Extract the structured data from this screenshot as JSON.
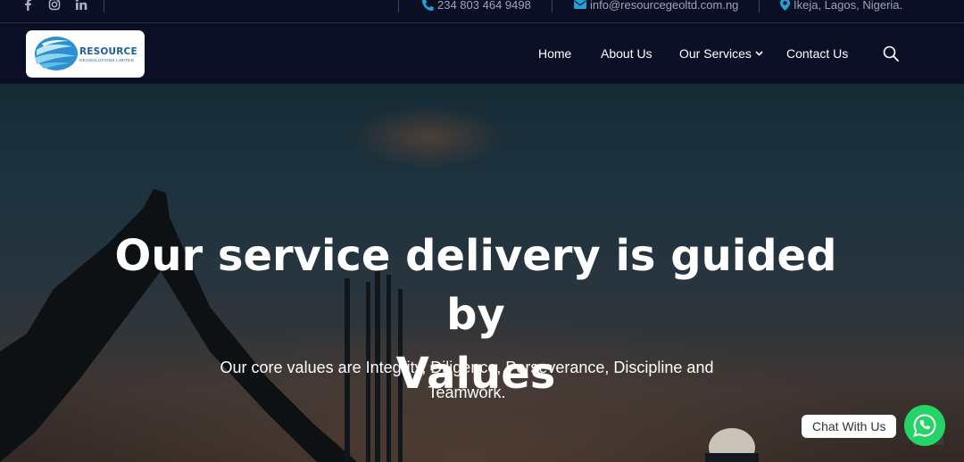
{
  "topbar": {
    "social": [
      {
        "icon": "facebook-icon"
      },
      {
        "icon": "instagram-icon"
      },
      {
        "icon": "linkedin-icon"
      }
    ],
    "phone": "234 803 464 9498",
    "email": "info@resourcegeoltd.com.ng",
    "location": "Ikeja, Lagos, Nigeria.",
    "accent_color": "#1fa3d8"
  },
  "logo": {
    "word": "RESOURCE",
    "subword": "GEOSOLUTIONS LIMITED"
  },
  "nav": {
    "items": [
      "Home",
      "About Us",
      "Our Services",
      "Contact Us"
    ],
    "search_icon": "search-icon"
  },
  "hero": {
    "title_line1": "Our service delivery is guided by",
    "title_line2": "Values",
    "subtitle_line1": "Our core values are Integrity, Diligence, Perseverance, Discipline and",
    "subtitle_line2": "Teamwork."
  },
  "chat": {
    "label": "Chat With Us",
    "color": "#25d366"
  }
}
